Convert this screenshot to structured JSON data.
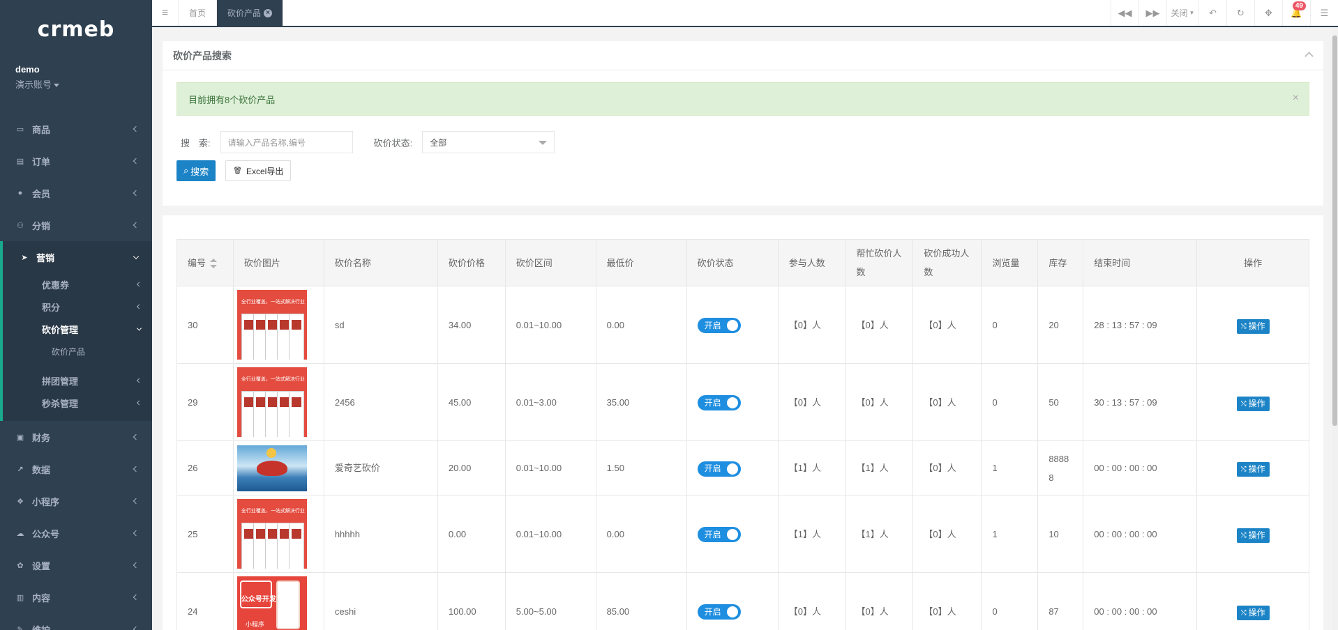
{
  "brand": {
    "logo_text": "crmeb"
  },
  "user": {
    "name": "demo",
    "role": "演示账号"
  },
  "sidebar": {
    "items": [
      {
        "label": "商品",
        "icon": "laptop-icon"
      },
      {
        "label": "订单",
        "icon": "file-icon"
      },
      {
        "label": "会员",
        "icon": "user-icon"
      },
      {
        "label": "分销",
        "icon": "users-icon"
      }
    ],
    "active": {
      "label": "营销",
      "icon": "paper-plane-icon",
      "children": [
        {
          "label": "优惠券"
        },
        {
          "label": "积分"
        },
        {
          "label": "砍价管理",
          "open": true
        },
        {
          "label": "砍价产品",
          "leaf": true
        },
        {
          "label": "拼团管理"
        },
        {
          "label": "秒杀管理"
        }
      ]
    },
    "items_after": [
      {
        "label": "财务",
        "icon": "money-icon"
      },
      {
        "label": "数据",
        "icon": "line-chart-icon"
      },
      {
        "label": "小程序",
        "icon": "cubes-icon"
      },
      {
        "label": "公众号",
        "icon": "wechat-icon"
      },
      {
        "label": "设置",
        "icon": "gear-icon"
      },
      {
        "label": "内容",
        "icon": "book-icon"
      },
      {
        "label": "维护",
        "icon": "wrench-icon"
      }
    ]
  },
  "topbar": {
    "tabs": [
      {
        "label": "首页",
        "active": false
      },
      {
        "label": "砍价产品",
        "active": true
      }
    ],
    "close_label": "关闭",
    "notification_count": "49"
  },
  "search_panel": {
    "title": "砍价产品搜索",
    "alert": "目前拥有8个砍价产品",
    "search_label": "搜　索:",
    "search_placeholder": "请输入产品名称,编号",
    "status_label": "砍价状态:",
    "status_value": "全部",
    "search_button": "搜索",
    "export_button": "Excel导出"
  },
  "table": {
    "headers": [
      "编号",
      "砍价图片",
      "砍价名称",
      "砍价价格",
      "砍价区间",
      "最低价",
      "砍价状态",
      "参与人数",
      "帮忙砍价人数",
      "砍价成功人数",
      "浏览量",
      "库存",
      "结束时间",
      "操作"
    ],
    "rows": [
      {
        "id": "30",
        "image": "red-promo",
        "name": "sd",
        "price": "34.00",
        "range": "0.01~10.00",
        "min": "0.00",
        "status": "开启",
        "participants": "【0】人",
        "helpers": "【0】人",
        "success": "【0】人",
        "views": "0",
        "stock": "20",
        "end": "28 : 13 : 57 : 09",
        "op": "操作"
      },
      {
        "id": "29",
        "image": "red-promo",
        "name": "2456",
        "price": "45.00",
        "range": "0.01~3.00",
        "min": "35.00",
        "status": "开启",
        "participants": "【0】人",
        "helpers": "【0】人",
        "success": "【0】人",
        "views": "0",
        "stock": "50",
        "end": "30 : 13 : 57 : 09",
        "op": "操作"
      },
      {
        "id": "26",
        "image": "sea-dragon",
        "name": "爱奇艺砍价",
        "price": "20.00",
        "range": "0.01~10.00",
        "min": "1.50",
        "status": "开启",
        "participants": "【1】人",
        "helpers": "【1】人",
        "success": "【0】人",
        "views": "1",
        "stock": "88888",
        "end": "00 : 00 : 00 : 00",
        "op": "操作"
      },
      {
        "id": "25",
        "image": "red-promo",
        "name": "hhhhh",
        "price": "0.00",
        "range": "0.01~10.00",
        "min": "0.00",
        "status": "开启",
        "participants": "【1】人",
        "helpers": "【1】人",
        "success": "【0】人",
        "views": "1",
        "stock": "10",
        "end": "00 : 00 : 00 : 00",
        "op": "操作"
      },
      {
        "id": "24",
        "image": "mini-program",
        "name": "ceshi",
        "price": "100.00",
        "range": "5.00~5.00",
        "min": "85.00",
        "status": "开启",
        "participants": "【0】人",
        "helpers": "【0】人",
        "success": "【0】人",
        "views": "0",
        "stock": "87",
        "end": "00 : 00 : 00 : 00",
        "op": "操作"
      }
    ],
    "thumb_text": {
      "red_promo_header": "全行业覆盖，一站式解决行业",
      "mp_title": "公众号开发",
      "mp_sub": "小程序"
    }
  },
  "colors": {
    "sidebar_bg": "#2f4050",
    "primary": "#1c84c6",
    "switch_on": "#1e8ee0",
    "badge": "#ed5565"
  }
}
